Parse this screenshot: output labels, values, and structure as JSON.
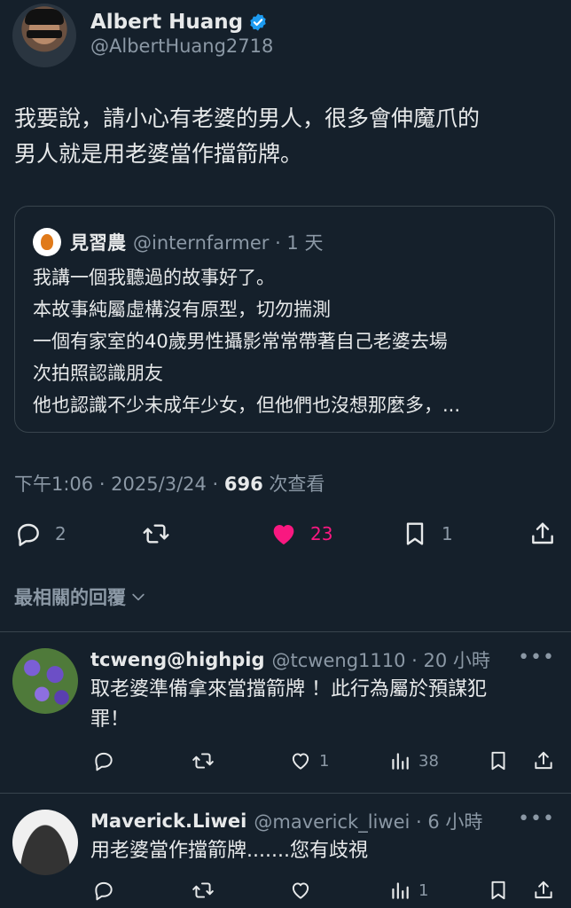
{
  "author": {
    "display_name": "Albert Huang",
    "handle": "@AlbertHuang2718"
  },
  "tweet": {
    "text_line1": "我要說，請小心有老婆的男人，很多會伸魔爪的",
    "text_line2": "男人就是用老婆當作擋箭牌。"
  },
  "quote": {
    "name": "見習農",
    "handle_time": "@internfarmer · 1 天",
    "lines": [
      "我講一個我聽過的故事好了。",
      "本故事純屬虛構沒有原型，切勿揣測",
      "一個有家室的40歲男性攝影常常帶著自己老婆去場",
      "次拍照認識朋友",
      "他也認識不少未成年少女，但他們也沒想那麼多，..."
    ]
  },
  "meta": {
    "time_date": "下午1:06 · 2025/3/24 · ",
    "views_count": "696",
    "views_label": " 次查看"
  },
  "actions": {
    "replies": "2",
    "likes": "23",
    "bookmarks": "1"
  },
  "sort_label": "最相關的回覆",
  "replies": [
    {
      "name": "tcweng@highpig",
      "handle_time": "@tcweng1110 · 20 小時",
      "text_line1": "取老婆準備拿來當擋箭牌 ！此行為屬於預謀犯",
      "text_line2": "罪！",
      "likes": "1",
      "views": "38"
    },
    {
      "name": "Maverick.Liwei",
      "handle_time": "@maverick_liwei · 6 小時",
      "text_line1": "用老婆當作擋箭牌.......您有歧視",
      "likes": "",
      "views": "1"
    }
  ],
  "colors": {
    "background": "#15202b",
    "text": "#e7e9ea",
    "secondary": "#8b98a5",
    "like_pink": "#f91880",
    "verified_blue": "#1d9bf0"
  }
}
